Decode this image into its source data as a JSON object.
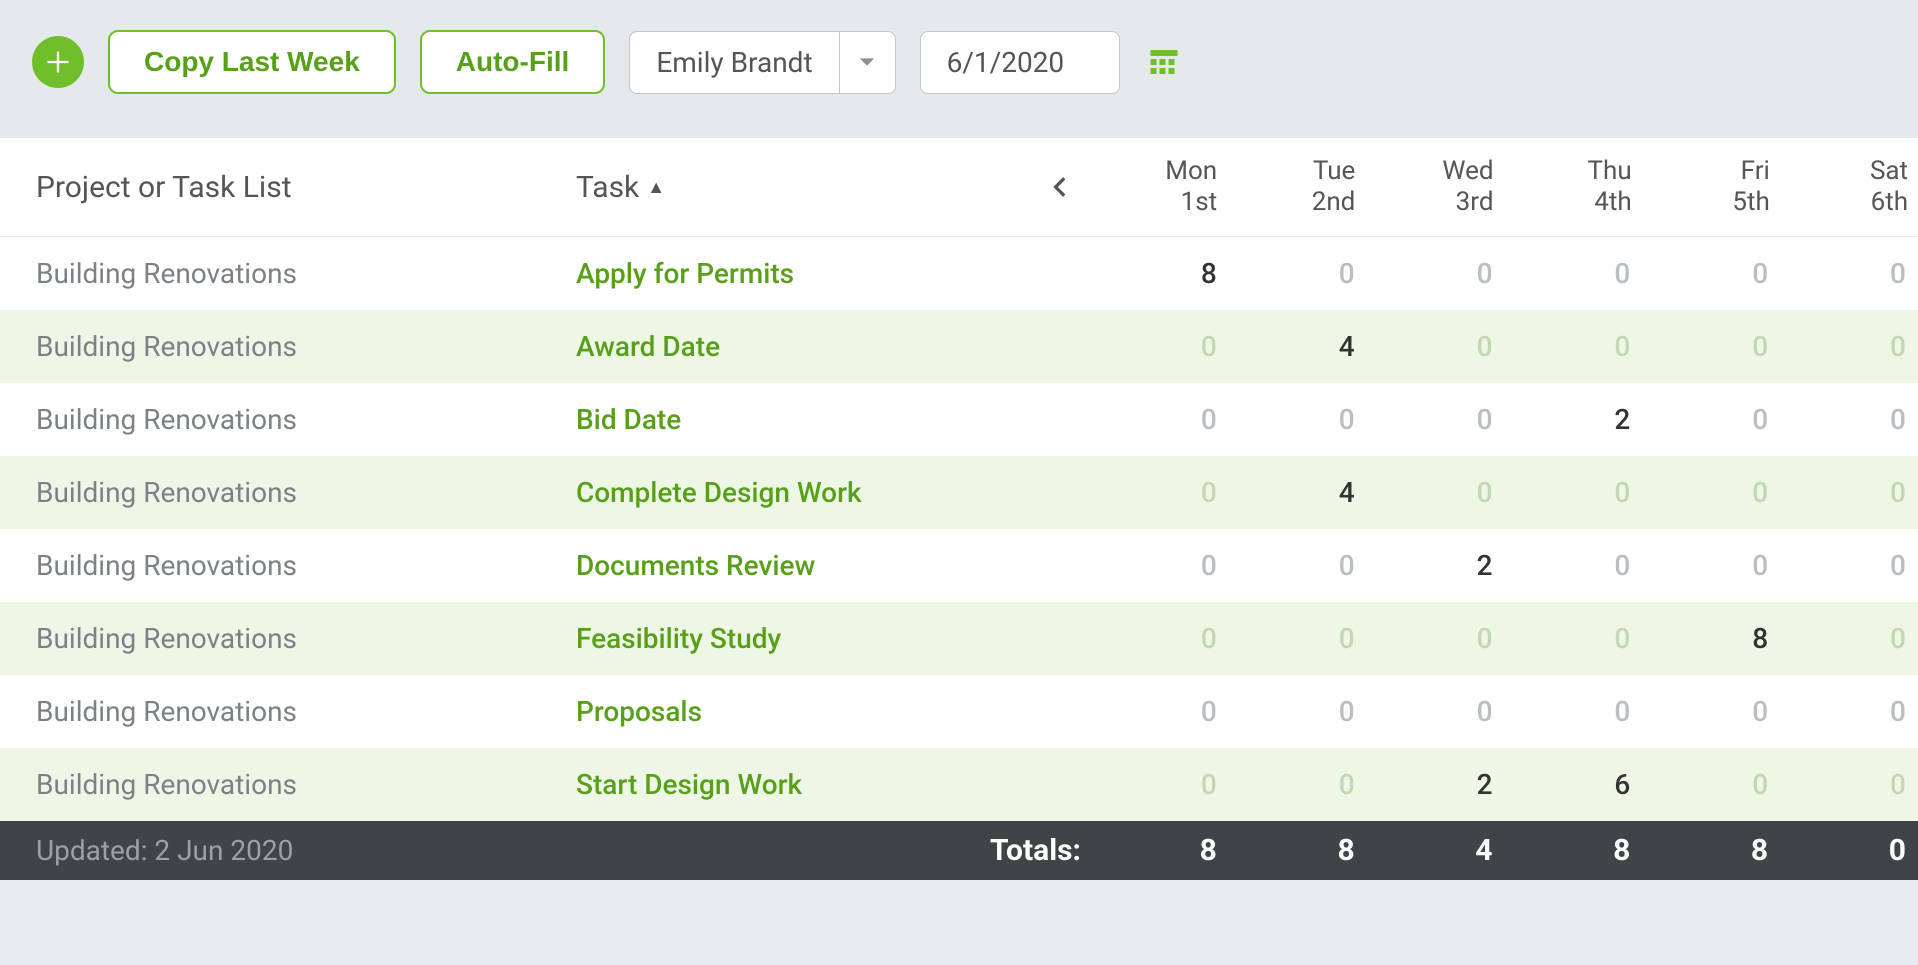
{
  "toolbar": {
    "copy_last_week_label": "Copy Last Week",
    "auto_fill_label": "Auto-Fill",
    "user_select_value": "Emily Brandt",
    "date_value": "6/1/2020"
  },
  "columns": {
    "project_header": "Project or Task List",
    "task_header": "Task",
    "sort_indicator": "▲",
    "days": [
      {
        "dow": "Mon",
        "dom": "1st"
      },
      {
        "dow": "Tue",
        "dom": "2nd"
      },
      {
        "dow": "Wed",
        "dom": "3rd"
      },
      {
        "dow": "Thu",
        "dom": "4th"
      },
      {
        "dow": "Fri",
        "dom": "5th"
      },
      {
        "dow": "Sat",
        "dom": "6th"
      }
    ]
  },
  "rows": [
    {
      "project": "Building Renovations",
      "task": "Apply for Permits",
      "hours": [
        8,
        0,
        0,
        0,
        0,
        0
      ]
    },
    {
      "project": "Building Renovations",
      "task": "Award Date",
      "hours": [
        0,
        4,
        0,
        0,
        0,
        0
      ]
    },
    {
      "project": "Building Renovations",
      "task": "Bid Date",
      "hours": [
        0,
        0,
        0,
        2,
        0,
        0
      ]
    },
    {
      "project": "Building Renovations",
      "task": "Complete Design Work",
      "hours": [
        0,
        4,
        0,
        0,
        0,
        0
      ]
    },
    {
      "project": "Building Renovations",
      "task": "Documents Review",
      "hours": [
        0,
        0,
        2,
        0,
        0,
        0
      ]
    },
    {
      "project": "Building Renovations",
      "task": "Feasibility Study",
      "hours": [
        0,
        0,
        0,
        0,
        8,
        0
      ]
    },
    {
      "project": "Building Renovations",
      "task": "Proposals",
      "hours": [
        0,
        0,
        0,
        0,
        0,
        0
      ]
    },
    {
      "project": "Building Renovations",
      "task": "Start Design Work",
      "hours": [
        0,
        0,
        2,
        6,
        0,
        0
      ]
    }
  ],
  "footer": {
    "updated_label": "Updated: 2 Jun 2020",
    "totals_label": "Totals:",
    "totals": [
      8,
      8,
      4,
      8,
      8,
      0
    ]
  }
}
